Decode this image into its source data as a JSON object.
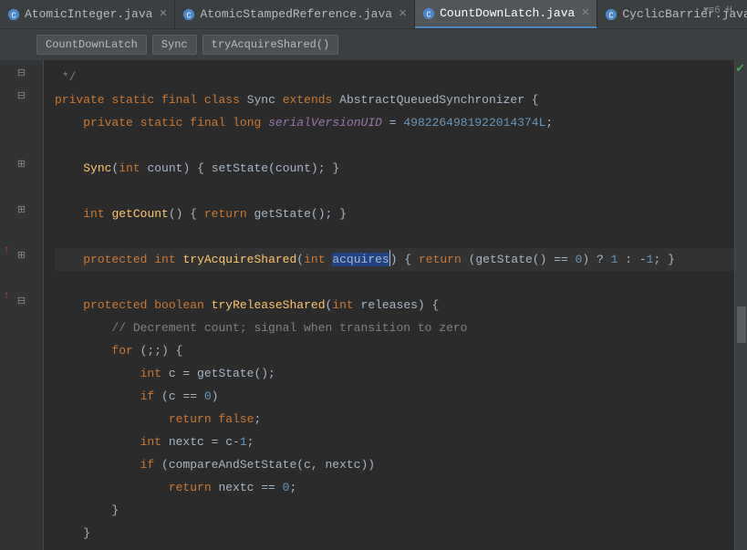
{
  "tabs": [
    {
      "label": "AtomicInteger.java",
      "active": false
    },
    {
      "label": "AtomicStampedReference.java",
      "active": false
    },
    {
      "label": "CountDownLatch.java",
      "active": true
    },
    {
      "label": "CyclicBarrier.java",
      "active": false
    }
  ],
  "breadcrumbs": {
    "c0": "CountDownLatch",
    "c1": "Sync",
    "c2": "tryAcquireShared()"
  },
  "topRight": "6 H",
  "code": {
    "l1_cmt": " */",
    "l2_kw1": "private",
    "l2_kw2": "static",
    "l2_kw3": "final",
    "l2_kw4": "class",
    "l2_cls": "Sync",
    "l2_kw5": "extends",
    "l2_sup": "AbstractQueuedSynchronizer {",
    "l3_kw1": "private",
    "l3_kw2": "static",
    "l3_kw3": "final",
    "l3_kw4": "long",
    "l3_fld": "serialVersionUID",
    "l3_eq": " = ",
    "l3_num": "4982264981922014374L",
    "l3_semi": ";",
    "l4_mth": "Sync",
    "l4_p1": "(",
    "l4_kw1": "int",
    "l4_arg": " count) ",
    "l4_lb": "{",
    "l4_call": " setState(count); ",
    "l4_rb": "}",
    "l5_kw1": "int",
    "l5_mth": "getCount",
    "l5_p": "() ",
    "l5_lb": "{",
    "l5_kw2": " return",
    "l5_call": " getState()",
    "l5_semi": ";",
    "l5_rb": " }",
    "l6_kw1": "protected",
    "l6_kw2": "int",
    "l6_mth": "tryAcquireShared",
    "l6_p1": "(",
    "l6_kw3": "int",
    "l6_sp": " ",
    "l6_sel": "acquires",
    "l6_p2": ") ",
    "l6_lb": "{",
    "l6_kw4": " return",
    "l6_call": " (getState() == ",
    "l6_n0": "0",
    "l6_q": ") ? ",
    "l6_n1": "1",
    "l6_col": " : -",
    "l6_n2": "1",
    "l6_end": "; }",
    "l7_kw1": "protected",
    "l7_kw2": "boolean",
    "l7_mth": "tryReleaseShared",
    "l7_p1": "(",
    "l7_kw3": "int",
    "l7_arg": " releases) {",
    "l8_cmt": "// Decrement count; signal when transition to zero",
    "l9_kw1": "for",
    "l9_rest": " (;;) {",
    "l10_kw1": "int",
    "l10_rest": " c = getState();",
    "l11_kw1": "if",
    "l11_r1": " (c == ",
    "l11_n": "0",
    "l11_r2": ")",
    "l12_kw1": "return",
    "l12_kw2": " false",
    "l12_semi": ";",
    "l13_kw1": "int",
    "l13_r1": " nextc = c-",
    "l13_n": "1",
    "l13_semi": ";",
    "l14_kw1": "if",
    "l14_r": " (compareAndSetState(c, nextc))",
    "l15_kw1": "return",
    "l15_r1": " nextc == ",
    "l15_n": "0",
    "l15_semi": ";",
    "l16": "}",
    "l17": "}"
  }
}
